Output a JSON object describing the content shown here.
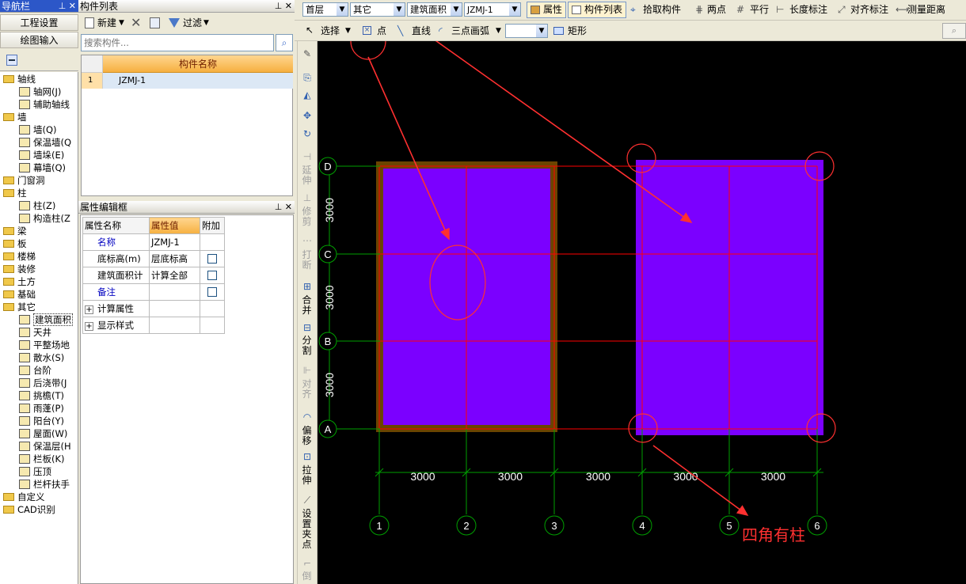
{
  "nav": {
    "title": "导航栏",
    "btn_settings": "工程设置",
    "btn_drawing": "绘图输入",
    "tree": [
      {
        "label": "轴线",
        "type": "folder",
        "level": 0
      },
      {
        "label": "轴网(J)",
        "type": "item",
        "level": 1
      },
      {
        "label": "辅助轴线",
        "type": "item",
        "level": 1
      },
      {
        "label": "墙",
        "type": "folder",
        "level": 0
      },
      {
        "label": "墙(Q)",
        "type": "item",
        "level": 1
      },
      {
        "label": "保温墙(Q",
        "type": "item",
        "level": 1
      },
      {
        "label": "墙垛(E)",
        "type": "item",
        "level": 1
      },
      {
        "label": "幕墙(Q)",
        "type": "item",
        "level": 1
      },
      {
        "label": "门窗洞",
        "type": "folder",
        "level": 0
      },
      {
        "label": "柱",
        "type": "folder",
        "level": 0
      },
      {
        "label": "柱(Z)",
        "type": "item",
        "level": 1
      },
      {
        "label": "构造柱(Z",
        "type": "item",
        "level": 1
      },
      {
        "label": "梁",
        "type": "folder",
        "level": 0
      },
      {
        "label": "板",
        "type": "folder",
        "level": 0
      },
      {
        "label": "楼梯",
        "type": "folder",
        "level": 0
      },
      {
        "label": "装修",
        "type": "folder",
        "level": 0
      },
      {
        "label": "土方",
        "type": "folder",
        "level": 0
      },
      {
        "label": "基础",
        "type": "folder",
        "level": 0
      },
      {
        "label": "其它",
        "type": "folder",
        "level": 0
      },
      {
        "label": "建筑面积",
        "type": "item",
        "level": 1,
        "selected": true
      },
      {
        "label": "天井",
        "type": "item",
        "level": 1
      },
      {
        "label": "平整场地",
        "type": "item",
        "level": 1
      },
      {
        "label": "散水(S)",
        "type": "item",
        "level": 1
      },
      {
        "label": "台阶",
        "type": "item",
        "level": 1
      },
      {
        "label": "后浇带(J",
        "type": "item",
        "level": 1
      },
      {
        "label": "挑檐(T)",
        "type": "item",
        "level": 1
      },
      {
        "label": "雨蓬(P)",
        "type": "item",
        "level": 1
      },
      {
        "label": "阳台(Y)",
        "type": "item",
        "level": 1
      },
      {
        "label": "屋面(W)",
        "type": "item",
        "level": 1
      },
      {
        "label": "保温层(H",
        "type": "item",
        "level": 1
      },
      {
        "label": "栏板(K)",
        "type": "item",
        "level": 1
      },
      {
        "label": "压顶",
        "type": "item",
        "level": 1
      },
      {
        "label": "栏杆扶手",
        "type": "item",
        "level": 1
      },
      {
        "label": "自定义",
        "type": "folder",
        "level": 0
      },
      {
        "label": "CAD识别",
        "type": "folder",
        "level": 0
      }
    ]
  },
  "component_list": {
    "title": "构件列表",
    "new_label": "新建",
    "filter_label": "过滤",
    "search_placeholder": "搜索构件...",
    "col_header": "构件名称",
    "rows": [
      {
        "index": "1",
        "name": "JZMJ-1"
      }
    ]
  },
  "property_editor": {
    "title": "属性编辑框",
    "headers": [
      "属性名称",
      "属性值",
      "附加"
    ],
    "rows": [
      {
        "name": "名称",
        "value": "JZMJ-1",
        "has_check": false,
        "blue": true
      },
      {
        "name": "底标高(m)",
        "value": "层底标高",
        "has_check": true,
        "blue": false
      },
      {
        "name": "建筑面积计",
        "value": "计算全部",
        "has_check": true,
        "blue": false
      },
      {
        "name": "备注",
        "value": "",
        "has_check": true,
        "blue": true
      },
      {
        "name": "计算属性",
        "value": "",
        "has_check": false,
        "blue": false,
        "expand": true
      },
      {
        "name": "显示样式",
        "value": "",
        "has_check": false,
        "blue": false,
        "expand": true
      }
    ]
  },
  "toolbar1": {
    "floor": "首层",
    "category": "其它",
    "type": "建筑面积",
    "component": "JZMJ-1",
    "btn_properties": "属性",
    "btn_component_list": "构件列表",
    "btn_pick": "拾取构件",
    "btn_two_points": "两点",
    "btn_parallel": "平行",
    "btn_length_dim": "长度标注",
    "btn_align_dim": "对齐标注",
    "btn_measure": "测量距离"
  },
  "toolbar2": {
    "btn_select": "选择",
    "btn_point": "点",
    "btn_line": "直线",
    "btn_arc": "三点画弧",
    "btn_rect": "矩形"
  },
  "vtools": {
    "extend": "延伸",
    "trim": "修剪",
    "break": "打断",
    "merge": "合并",
    "split": "分割",
    "align": "对齐",
    "offset": "偏移",
    "stretch": "拉伸",
    "set_grip": "设置夹点",
    "chamfer": "倒"
  },
  "drawing": {
    "row_labels": [
      "D",
      "C",
      "B",
      "A"
    ],
    "row_dims": [
      "3000",
      "3000",
      "3000"
    ],
    "col_labels": [
      "1",
      "2",
      "3",
      "4",
      "5",
      "6"
    ],
    "col_dims": [
      "3000",
      "3000",
      "3000",
      "3000",
      "3000"
    ],
    "annotation": "四角有柱",
    "colors": {
      "area_fill": "#7b00ff",
      "area_border": "#6b4400",
      "axis_line": "#ff0000",
      "dim_line": "#00a000",
      "annotation": "#ff3030"
    }
  }
}
